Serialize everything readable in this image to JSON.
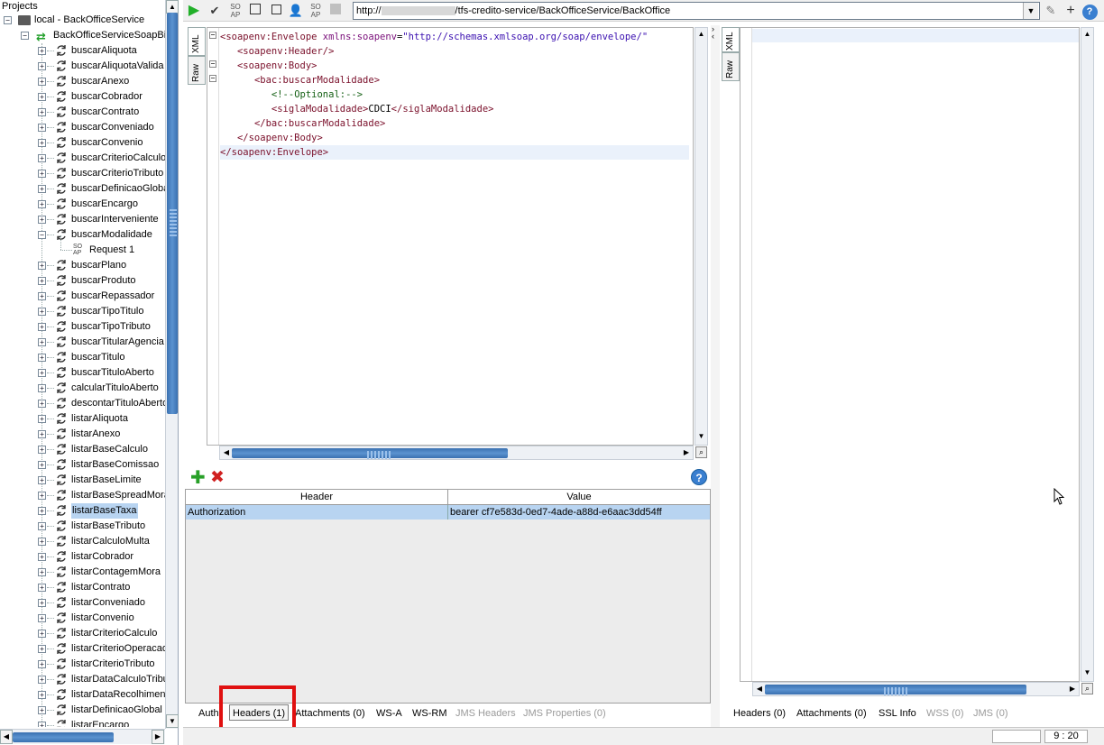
{
  "app": {
    "panel_title": "Projects"
  },
  "tree": {
    "project": "local - BackOfficeService",
    "binding": "BackOfficeServiceSoapBin",
    "operations": [
      "buscarAliquota",
      "buscarAliquotaValida",
      "buscarAnexo",
      "buscarCobrador",
      "buscarContrato",
      "buscarConveniado",
      "buscarConvenio",
      "buscarCriterioCalculo",
      "buscarCriterioTributo",
      "buscarDefinicaoGloba",
      "buscarEncargo",
      "buscarInterveniente",
      "buscarModalidade"
    ],
    "request_item": "Request 1",
    "operations_after": [
      "buscarPlano",
      "buscarProduto",
      "buscarRepassador",
      "buscarTipoTitulo",
      "buscarTipoTributo",
      "buscarTitularAgencia",
      "buscarTitulo",
      "buscarTituloAberto",
      "calcularTituloAberto",
      "descontarTituloAberto",
      "listarAliquota",
      "listarAnexo",
      "listarBaseCalculo",
      "listarBaseComissao",
      "listarBaseLimite",
      "listarBaseSpreadMora",
      "listarBaseTaxa",
      "listarBaseTributo",
      "listarCalculoMulta",
      "listarCobrador",
      "listarContagemMora",
      "listarContrato",
      "listarConveniado",
      "listarConvenio",
      "listarCriterioCalculo",
      "listarCriterioOperacao",
      "listarCriterioTributo",
      "listarDataCalculoTribu",
      "listarDataRecolhiment",
      "listarDefinicaoGlobal",
      "listarEncargo"
    ],
    "selected": "listarBaseTaxa"
  },
  "toolbar": {
    "url_prefix": "http://",
    "url_suffix": "/tfs-credito-service/BackOfficeService/BackOffice"
  },
  "request": {
    "tabs": [
      "XML",
      "Raw"
    ],
    "lines": [
      {
        "indent": 0,
        "parts": [
          [
            "tag",
            "<soapenv:Envelope "
          ],
          [
            "attr",
            "xmlns:soapenv"
          ],
          [
            "txt",
            "="
          ],
          [
            "str",
            "\"http://schemas.xmlsoap.org/soap/envelope/\""
          ]
        ]
      },
      {
        "indent": 3,
        "parts": [
          [
            "tag",
            "<soapenv:Header/>"
          ]
        ]
      },
      {
        "indent": 3,
        "parts": [
          [
            "tag",
            "<soapenv:Body>"
          ]
        ]
      },
      {
        "indent": 6,
        "parts": [
          [
            "tag",
            "<bac:buscarModalidade>"
          ]
        ]
      },
      {
        "indent": 9,
        "parts": [
          [
            "cmt",
            "<!--Optional:-->"
          ]
        ]
      },
      {
        "indent": 9,
        "parts": [
          [
            "tag",
            "<siglaModalidade>"
          ],
          [
            "txt",
            "CDCI"
          ],
          [
            "tag",
            "</siglaModalidade>"
          ]
        ]
      },
      {
        "indent": 6,
        "parts": [
          [
            "tag",
            "</bac:buscarModalidade>"
          ]
        ]
      },
      {
        "indent": 3,
        "parts": [
          [
            "tag",
            "</soapenv:Body>"
          ]
        ]
      },
      {
        "indent": 0,
        "parts": [
          [
            "tag",
            "</soapenv:Envelope>"
          ]
        ]
      }
    ]
  },
  "headers": {
    "columns": [
      "Header",
      "Value"
    ],
    "rows": [
      {
        "header": "Authorization",
        "value": "bearer cf7e583d-0ed7-4ade-a88d-e6aac3dd54ff"
      }
    ]
  },
  "request_tabs": {
    "auth": "Auth",
    "headers": "Headers (1)",
    "attachments": "Attachments (0)",
    "wsa": "WS-A",
    "wsrm": "WS-RM",
    "jms_headers": "JMS Headers",
    "jms_properties": "JMS Properties (0)"
  },
  "response": {
    "tabs": [
      "XML",
      "Raw"
    ]
  },
  "response_tabs": {
    "headers": "Headers (0)",
    "attachments": "Attachments (0)",
    "ssl": "SSL Info",
    "wss": "WSS (0)",
    "jms": "JMS (0)"
  },
  "status": {
    "position": "9 : 20"
  },
  "colors": {
    "selection": "#b8d4f1",
    "highlight_box": "#e01010",
    "accent": "#3a7fd0"
  }
}
